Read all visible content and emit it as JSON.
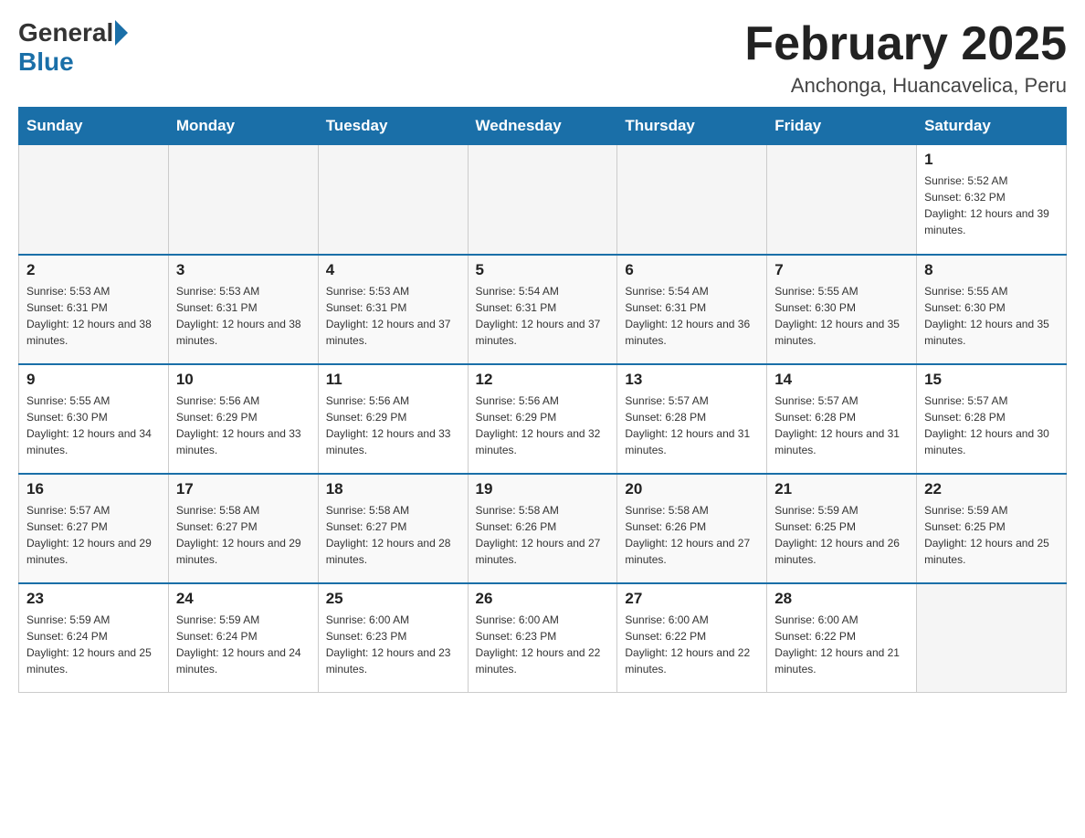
{
  "header": {
    "logo_general": "General",
    "logo_blue": "Blue",
    "month_title": "February 2025",
    "location": "Anchonga, Huancavelica, Peru"
  },
  "days_of_week": [
    "Sunday",
    "Monday",
    "Tuesday",
    "Wednesday",
    "Thursday",
    "Friday",
    "Saturday"
  ],
  "weeks": [
    [
      {
        "day": "",
        "info": ""
      },
      {
        "day": "",
        "info": ""
      },
      {
        "day": "",
        "info": ""
      },
      {
        "day": "",
        "info": ""
      },
      {
        "day": "",
        "info": ""
      },
      {
        "day": "",
        "info": ""
      },
      {
        "day": "1",
        "info": "Sunrise: 5:52 AM\nSunset: 6:32 PM\nDaylight: 12 hours and 39 minutes."
      }
    ],
    [
      {
        "day": "2",
        "info": "Sunrise: 5:53 AM\nSunset: 6:31 PM\nDaylight: 12 hours and 38 minutes."
      },
      {
        "day": "3",
        "info": "Sunrise: 5:53 AM\nSunset: 6:31 PM\nDaylight: 12 hours and 38 minutes."
      },
      {
        "day": "4",
        "info": "Sunrise: 5:53 AM\nSunset: 6:31 PM\nDaylight: 12 hours and 37 minutes."
      },
      {
        "day": "5",
        "info": "Sunrise: 5:54 AM\nSunset: 6:31 PM\nDaylight: 12 hours and 37 minutes."
      },
      {
        "day": "6",
        "info": "Sunrise: 5:54 AM\nSunset: 6:31 PM\nDaylight: 12 hours and 36 minutes."
      },
      {
        "day": "7",
        "info": "Sunrise: 5:55 AM\nSunset: 6:30 PM\nDaylight: 12 hours and 35 minutes."
      },
      {
        "day": "8",
        "info": "Sunrise: 5:55 AM\nSunset: 6:30 PM\nDaylight: 12 hours and 35 minutes."
      }
    ],
    [
      {
        "day": "9",
        "info": "Sunrise: 5:55 AM\nSunset: 6:30 PM\nDaylight: 12 hours and 34 minutes."
      },
      {
        "day": "10",
        "info": "Sunrise: 5:56 AM\nSunset: 6:29 PM\nDaylight: 12 hours and 33 minutes."
      },
      {
        "day": "11",
        "info": "Sunrise: 5:56 AM\nSunset: 6:29 PM\nDaylight: 12 hours and 33 minutes."
      },
      {
        "day": "12",
        "info": "Sunrise: 5:56 AM\nSunset: 6:29 PM\nDaylight: 12 hours and 32 minutes."
      },
      {
        "day": "13",
        "info": "Sunrise: 5:57 AM\nSunset: 6:28 PM\nDaylight: 12 hours and 31 minutes."
      },
      {
        "day": "14",
        "info": "Sunrise: 5:57 AM\nSunset: 6:28 PM\nDaylight: 12 hours and 31 minutes."
      },
      {
        "day": "15",
        "info": "Sunrise: 5:57 AM\nSunset: 6:28 PM\nDaylight: 12 hours and 30 minutes."
      }
    ],
    [
      {
        "day": "16",
        "info": "Sunrise: 5:57 AM\nSunset: 6:27 PM\nDaylight: 12 hours and 29 minutes."
      },
      {
        "day": "17",
        "info": "Sunrise: 5:58 AM\nSunset: 6:27 PM\nDaylight: 12 hours and 29 minutes."
      },
      {
        "day": "18",
        "info": "Sunrise: 5:58 AM\nSunset: 6:27 PM\nDaylight: 12 hours and 28 minutes."
      },
      {
        "day": "19",
        "info": "Sunrise: 5:58 AM\nSunset: 6:26 PM\nDaylight: 12 hours and 27 minutes."
      },
      {
        "day": "20",
        "info": "Sunrise: 5:58 AM\nSunset: 6:26 PM\nDaylight: 12 hours and 27 minutes."
      },
      {
        "day": "21",
        "info": "Sunrise: 5:59 AM\nSunset: 6:25 PM\nDaylight: 12 hours and 26 minutes."
      },
      {
        "day": "22",
        "info": "Sunrise: 5:59 AM\nSunset: 6:25 PM\nDaylight: 12 hours and 25 minutes."
      }
    ],
    [
      {
        "day": "23",
        "info": "Sunrise: 5:59 AM\nSunset: 6:24 PM\nDaylight: 12 hours and 25 minutes."
      },
      {
        "day": "24",
        "info": "Sunrise: 5:59 AM\nSunset: 6:24 PM\nDaylight: 12 hours and 24 minutes."
      },
      {
        "day": "25",
        "info": "Sunrise: 6:00 AM\nSunset: 6:23 PM\nDaylight: 12 hours and 23 minutes."
      },
      {
        "day": "26",
        "info": "Sunrise: 6:00 AM\nSunset: 6:23 PM\nDaylight: 12 hours and 22 minutes."
      },
      {
        "day": "27",
        "info": "Sunrise: 6:00 AM\nSunset: 6:22 PM\nDaylight: 12 hours and 22 minutes."
      },
      {
        "day": "28",
        "info": "Sunrise: 6:00 AM\nSunset: 6:22 PM\nDaylight: 12 hours and 21 minutes."
      },
      {
        "day": "",
        "info": ""
      }
    ]
  ]
}
